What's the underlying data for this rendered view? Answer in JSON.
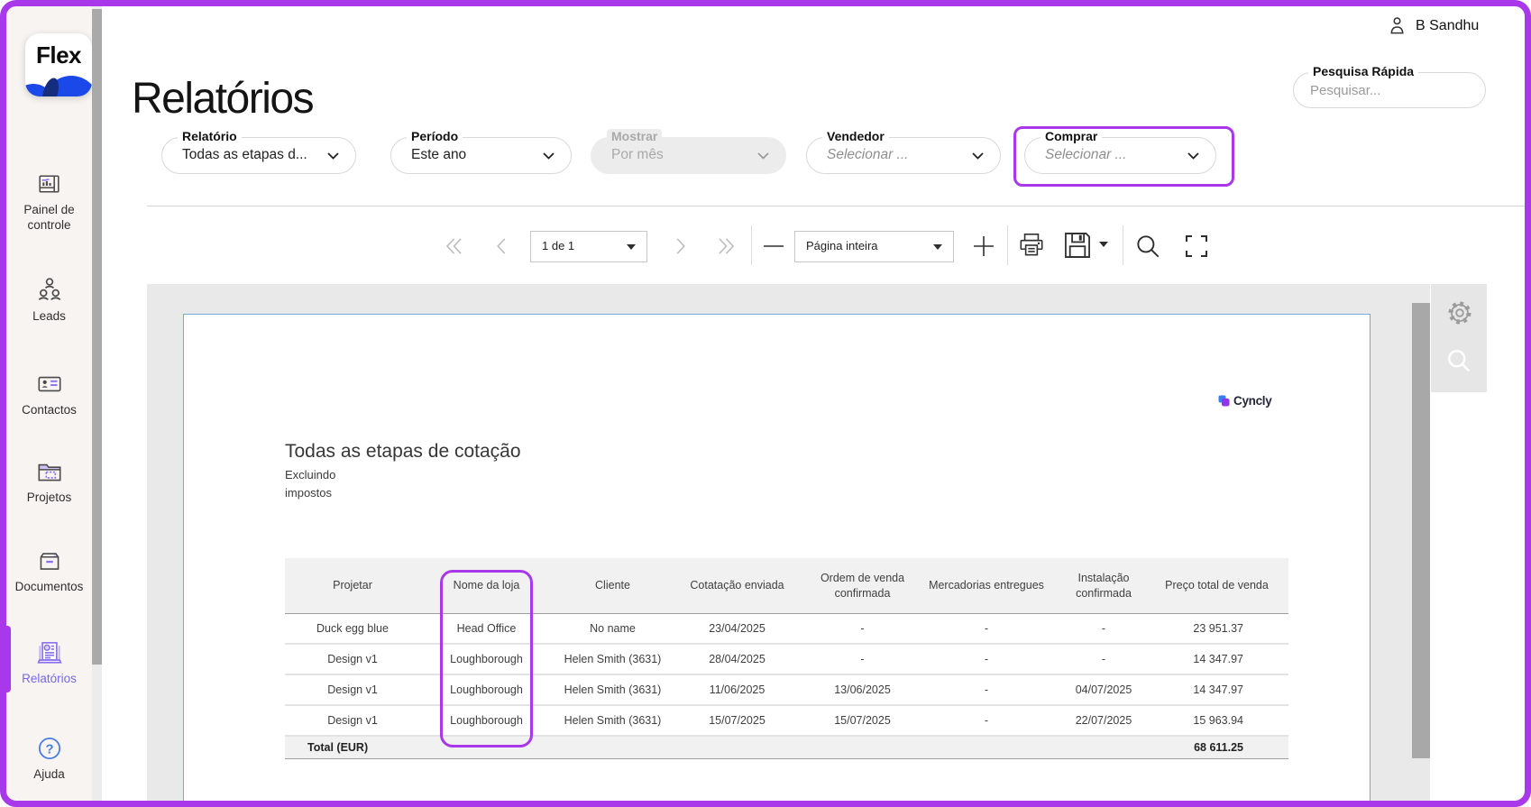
{
  "colors": {
    "accent_purple": "#a838ea",
    "active_nav_purple": "#7668e8",
    "flex_blue": "#1b49e9",
    "viewer_bg": "#e9e9e9",
    "page_border_blue": "#79a7dc"
  },
  "brand": {
    "logo_text": "Flex"
  },
  "user": {
    "name": "B Sandhu"
  },
  "page_title": "Relatórios",
  "sidebar": {
    "items": [
      {
        "label": "Painel de controle"
      },
      {
        "label": "Leads"
      },
      {
        "label": "Contactos"
      },
      {
        "label": "Projetos"
      },
      {
        "label": "Documentos"
      },
      {
        "label": "Relatórios"
      },
      {
        "label": "Ajuda"
      }
    ]
  },
  "search": {
    "label": "Pesquisa Rápida",
    "placeholder": "Pesquisar..."
  },
  "filters": {
    "relatorio": {
      "label": "Relatório",
      "value": "Todas as etapas d..."
    },
    "periodo": {
      "label": "Período",
      "value": "Este ano"
    },
    "mostrar": {
      "label": "Mostrar",
      "value": "Por mês"
    },
    "vendedor": {
      "label": "Vendedor",
      "value": "Selecionar ..."
    },
    "comprar": {
      "label": "Comprar",
      "value": "Selecionar ..."
    }
  },
  "toolbar": {
    "page_indicator": "1 de 1",
    "zoom_mode": "Página inteira"
  },
  "report": {
    "vendor_logo": "Cyncly",
    "title": "Todas as etapas de cotação",
    "subtitle_line1": "Excluindo",
    "subtitle_line2": "impostos",
    "table": {
      "headers": [
        "Projetar",
        "Nome da loja",
        "Cliente",
        "Cotatação enviada",
        "Ordem de venda confirmada",
        "Mercadorias entregues",
        "Instalação confirmada",
        "Preço total de venda"
      ],
      "rows": [
        [
          "Duck egg blue",
          "Head Office",
          "No name",
          "23/04/2025",
          "-",
          "-",
          "-",
          "23 951.37"
        ],
        [
          "Design v1",
          "Loughborough",
          "Helen Smith (3631)",
          "28/04/2025",
          "-",
          "-",
          "-",
          "14 347.97"
        ],
        [
          "Design v1",
          "Loughborough",
          "Helen Smith (3631)",
          "11/06/2025",
          "13/06/2025",
          "-",
          "04/07/2025",
          "14 347.97"
        ],
        [
          "Design v1",
          "Loughborough",
          "Helen Smith (3631)",
          "15/07/2025",
          "15/07/2025",
          "-",
          "22/07/2025",
          "15 963.94"
        ]
      ],
      "total_label": "Total (EUR)",
      "total_value": "68 611.25"
    }
  }
}
